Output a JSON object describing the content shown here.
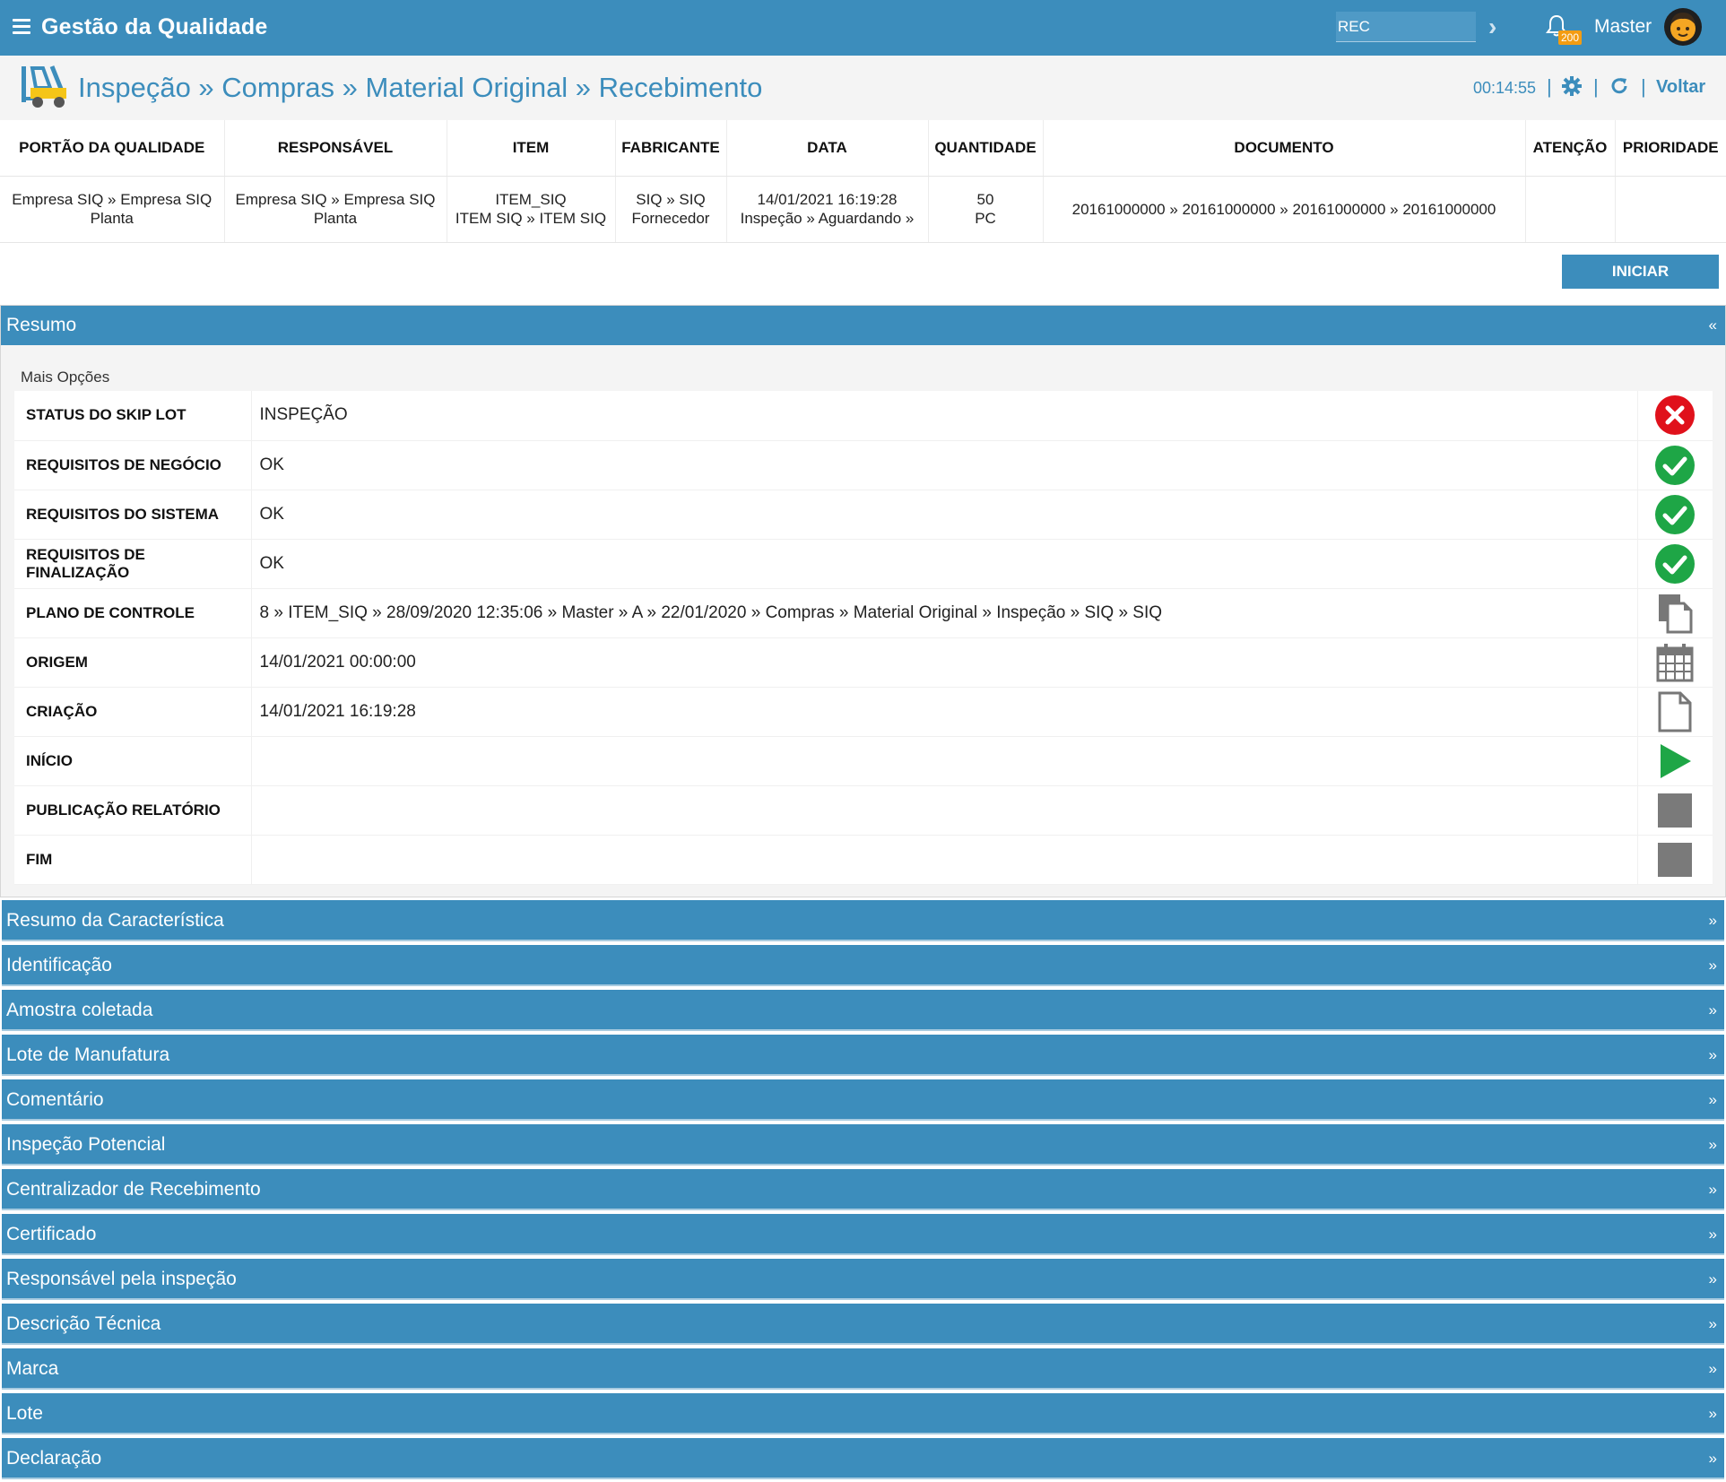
{
  "topbar": {
    "app_title": "Gestão da Qualidade",
    "search_value": "REC",
    "notification_count": "200",
    "user_name": "Master"
  },
  "breadcrumb": {
    "text": "Inspeção » Compras » Material Original » Recebimento",
    "timer": "00:14:55",
    "back_label": "Voltar"
  },
  "header_table": {
    "columns": [
      "PORTÃO DA QUALIDADE",
      "RESPONSÁVEL",
      "ITEM",
      "FABRICANTE",
      "DATA",
      "QUANTIDADE",
      "DOCUMENTO",
      "ATENÇÃO",
      "PRIORIDADE"
    ],
    "row": {
      "portao": [
        "Empresa SIQ » Empresa SIQ",
        "Planta"
      ],
      "responsavel": [
        "Empresa SIQ » Empresa SIQ",
        "Planta"
      ],
      "item": [
        "ITEM_SIQ",
        "ITEM SIQ » ITEM SIQ"
      ],
      "fabricante": [
        "SIQ » SIQ",
        "Fornecedor"
      ],
      "data": [
        "14/01/2021 16:19:28",
        "Inspeção » Aguardando »"
      ],
      "quantidade": [
        "50",
        "PC"
      ],
      "documento": "20161000000 » 20161000000 » 20161000000 » 20161000000",
      "atencao": "",
      "prioridade": ""
    }
  },
  "start_button_label": "INICIAR",
  "resumo": {
    "title": "Resumo",
    "toggle": "«",
    "more_options": "Mais Opções",
    "rows": [
      {
        "label": "STATUS DO SKIP LOT",
        "value": "INSPEÇÃO",
        "icon": "error-circle-icon"
      },
      {
        "label": "REQUISITOS DE NEGÓCIO",
        "value": "OK",
        "icon": "check-circle-icon"
      },
      {
        "label": "REQUISITOS DO SISTEMA",
        "value": "OK",
        "icon": "check-circle-icon"
      },
      {
        "label": "REQUISITOS DE FINALIZAÇÃO",
        "value": "OK",
        "icon": "check-circle-icon"
      },
      {
        "label": "PLANO DE CONTROLE",
        "value": "8 » ITEM_SIQ » 28/09/2020 12:35:06 » Master » A » 22/01/2020 » Compras » Material Original » Inspeção » SIQ » SIQ",
        "icon": "copy-icon"
      },
      {
        "label": "ORIGEM",
        "value": "14/01/2021 00:00:00",
        "icon": "calendar-icon"
      },
      {
        "label": "CRIAÇÃO",
        "value": "14/01/2021 16:19:28",
        "icon": "document-icon"
      },
      {
        "label": "INÍCIO",
        "value": "",
        "icon": "play-icon"
      },
      {
        "label": "PUBLICAÇÃO RELATÓRIO",
        "value": "",
        "icon": "stop-icon"
      },
      {
        "label": "FIM",
        "value": "",
        "icon": "stop-icon"
      }
    ]
  },
  "collapsed_panels": {
    "toggle": "»",
    "items": [
      "Resumo da Característica",
      "Identificação",
      "Amostra coletada",
      "Lote de Manufatura",
      "Comentário",
      "Inspeção Potencial",
      "Centralizador de Recebimento",
      "Certificado",
      "Responsável pela inspeção",
      "Descrição Técnica",
      "Marca",
      "Lote",
      "Declaração"
    ]
  },
  "colors": {
    "primary": "#3c8dbc",
    "error": "#c0141c",
    "success": "#1ea646",
    "badge": "#f39c12"
  }
}
